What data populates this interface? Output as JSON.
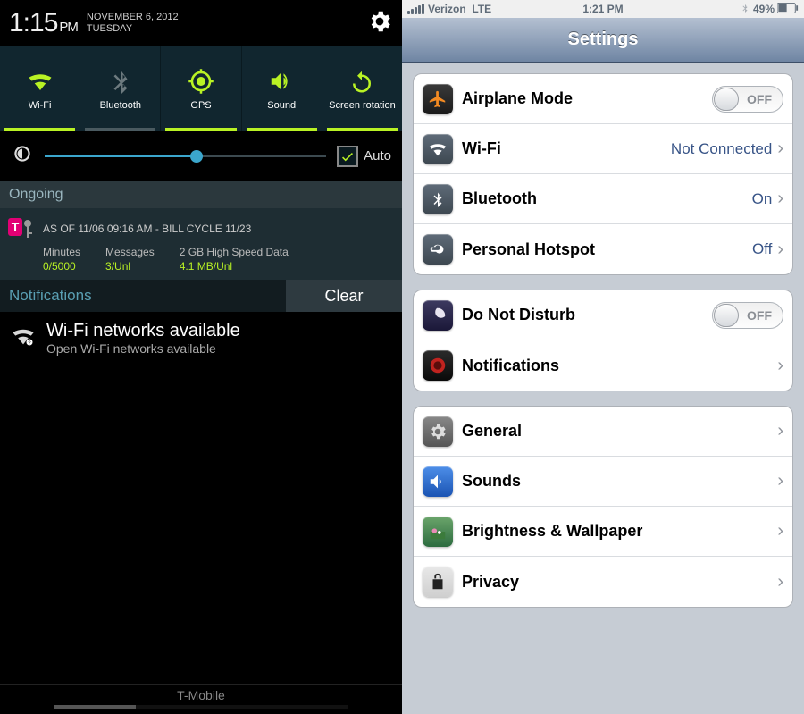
{
  "android": {
    "status": {
      "time": "1:15",
      "ampm": "PM",
      "date_line1": "NOVEMBER 6, 2012",
      "date_line2": "TUESDAY"
    },
    "toggles": [
      {
        "label": "Wi-Fi",
        "icon": "wifi-icon",
        "on": true
      },
      {
        "label": "Bluetooth",
        "icon": "bluetooth-icon",
        "on": false
      },
      {
        "label": "GPS",
        "icon": "gps-icon",
        "on": true
      },
      {
        "label": "Sound",
        "icon": "sound-icon",
        "on": true
      },
      {
        "label": "Screen rotation",
        "icon": "rotation-icon",
        "on": true
      }
    ],
    "brightness": {
      "auto_label": "Auto",
      "value_percent": 54
    },
    "ongoing": {
      "header": "Ongoing",
      "title": "AS OF 11/06 09:16 AM - BILL CYCLE 11/23",
      "stats": [
        {
          "k": "Minutes",
          "v": "0/5000"
        },
        {
          "k": "Messages",
          "v": "3/Unl"
        },
        {
          "k": "2 GB High Speed Data",
          "v": "4.1 MB/Unl"
        }
      ]
    },
    "notifications": {
      "header": "Notifications",
      "clear": "Clear",
      "items": [
        {
          "title": "Wi-Fi networks available",
          "subtitle": "Open Wi-Fi networks available",
          "icon": "wifi-open-icon"
        }
      ]
    },
    "footer": {
      "carrier": "T-Mobile"
    }
  },
  "ios": {
    "status": {
      "carrier": "Verizon",
      "network": "LTE",
      "time": "1:21 PM",
      "battery": "49%"
    },
    "header": "Settings",
    "groups": [
      [
        {
          "icon": "airplane",
          "label": "Airplane Mode",
          "toggle": "OFF"
        },
        {
          "icon": "wifi",
          "label": "Wi-Fi",
          "value": "Not Connected",
          "chevron": true
        },
        {
          "icon": "bt",
          "label": "Bluetooth",
          "value": "On",
          "chevron": true
        },
        {
          "icon": "hotspot",
          "label": "Personal Hotspot",
          "value": "Off",
          "chevron": true
        }
      ],
      [
        {
          "icon": "dnd",
          "label": "Do Not Disturb",
          "toggle": "OFF"
        },
        {
          "icon": "notif",
          "label": "Notifications",
          "chevron": true
        }
      ],
      [
        {
          "icon": "general",
          "label": "General",
          "chevron": true
        },
        {
          "icon": "sounds",
          "label": "Sounds",
          "chevron": true
        },
        {
          "icon": "bright",
          "label": "Brightness & Wallpaper",
          "chevron": true
        },
        {
          "icon": "privacy",
          "label": "Privacy",
          "chevron": true
        }
      ]
    ]
  }
}
